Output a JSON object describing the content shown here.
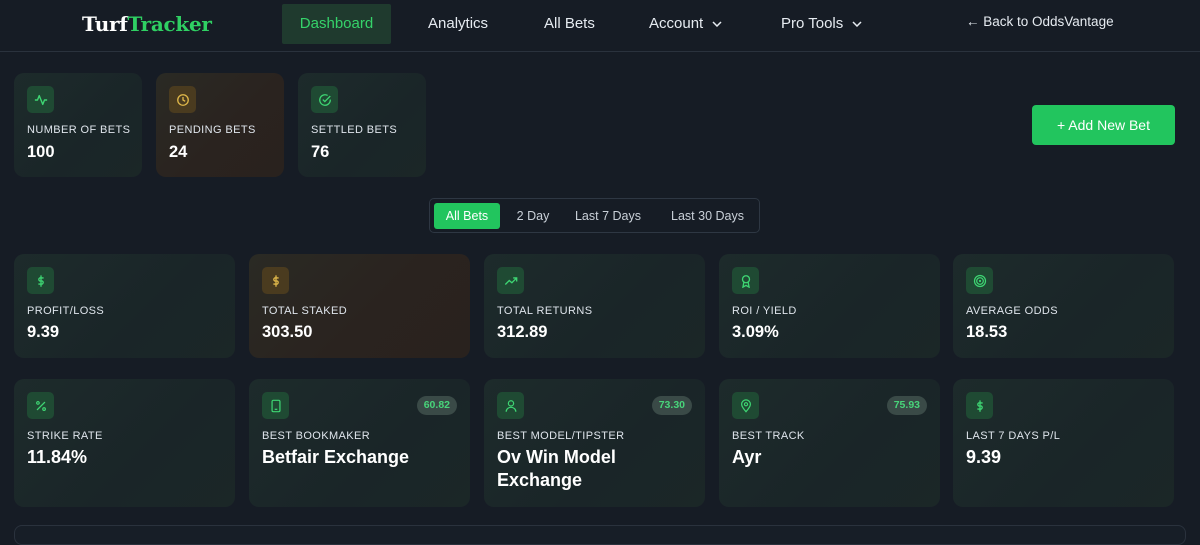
{
  "brand": {
    "part1": "Turf",
    "part2": "Tracker"
  },
  "nav": {
    "dashboard": "Dashboard",
    "analytics": "Analytics",
    "all_bets": "All Bets",
    "account": "Account",
    "pro_tools": "Pro Tools",
    "back": "← Back to OddsVantage"
  },
  "summary": [
    {
      "label": "NUMBER OF BETS",
      "value": "100",
      "icon": "activity-icon"
    },
    {
      "label": "PENDING BETS",
      "value": "24",
      "icon": "clock-icon"
    },
    {
      "label": "SETTLED BETS",
      "value": "76",
      "icon": "check-circle-icon"
    }
  ],
  "add_bet_label": "+ Add New Bet",
  "filters": [
    "All Bets",
    "2 Day",
    "Last 7 Days",
    "Last 30 Days"
  ],
  "active_filter": "All Bets",
  "stats_row1": [
    {
      "label": "PROFIT/LOSS",
      "value": "9.39",
      "icon": "dollar-icon"
    },
    {
      "label": "TOTAL STAKED",
      "value": "303.50",
      "icon": "dollar-icon"
    },
    {
      "label": "TOTAL RETURNS",
      "value": "312.89",
      "icon": "trending-up-icon"
    },
    {
      "label": "ROI / YIELD",
      "value": "3.09%",
      "icon": "award-icon"
    },
    {
      "label": "AVERAGE ODDS",
      "value": "18.53",
      "icon": "target-icon"
    }
  ],
  "stats_row2": [
    {
      "label": "STRIKE RATE",
      "value": "11.84%",
      "icon": "percent-icon"
    },
    {
      "label": "BEST BOOKMAKER",
      "value": "Betfair Exchange",
      "badge": "60.82",
      "icon": "tablet-icon"
    },
    {
      "label": "BEST MODEL/TIPSTER",
      "value": "Ov Win Model Exchange",
      "badge": "73.30",
      "icon": "user-icon"
    },
    {
      "label": "BEST TRACK",
      "value": "Ayr",
      "badge": "75.93",
      "icon": "map-pin-icon"
    },
    {
      "label": "LAST 7 DAYS P/L",
      "value": "9.39",
      "icon": "dollar-icon"
    }
  ],
  "colors": {
    "accent": "#22c55e",
    "background": "#161c25",
    "warning": "#e0b84a"
  }
}
